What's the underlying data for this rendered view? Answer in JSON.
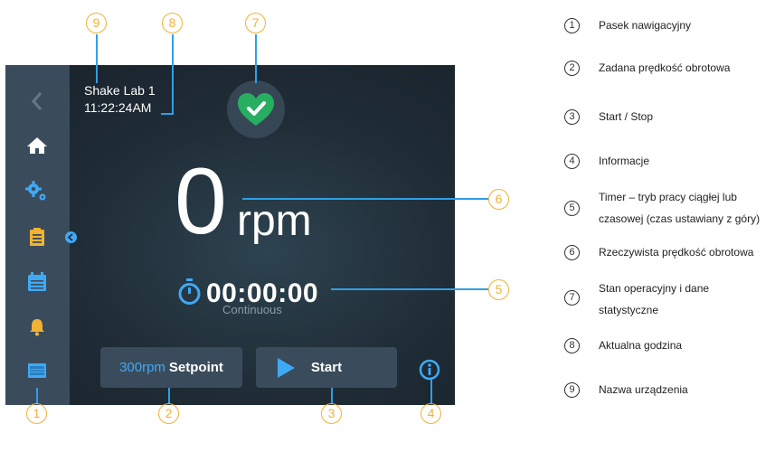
{
  "device": {
    "name": "Shake Lab 1",
    "time": "11:22:24AM",
    "speed_value": "0",
    "speed_unit": "rpm",
    "timer": "00:00:00",
    "timer_mode": "Continuous",
    "setpoint_value": "300rpm",
    "setpoint_label": "Setpoint",
    "start_label": "Start"
  },
  "sidebar_icons": [
    "back-chevron-icon",
    "home-icon",
    "settings-gears-icon",
    "clipboard-icon",
    "calendar-icon",
    "bell-icon",
    "screen-icon"
  ],
  "callouts": [
    "1",
    "2",
    "3",
    "4",
    "5",
    "6",
    "7",
    "8",
    "9"
  ],
  "legend": [
    {
      "num": "1",
      "text": "Pasek nawigacyjny"
    },
    {
      "num": "2",
      "text": "Zadana prędkość obrotowa"
    },
    {
      "num": "3",
      "text": "Start / Stop"
    },
    {
      "num": "4",
      "text": "Informacje"
    },
    {
      "num": "5",
      "text": "Timer – tryb pracy ciągłej lub czasowej (czas ustawiany z góry)"
    },
    {
      "num": "6",
      "text": "Rzeczywista prędkość obrotowa"
    },
    {
      "num": "7",
      "text": "Stan operacyjny i dane statystyczne"
    },
    {
      "num": "8",
      "text": "Aktualna godzina"
    },
    {
      "num": "9",
      "text": "Nazwa urządzenia"
    }
  ],
  "colors": {
    "accent": "#2f9fe6",
    "callout": "#f2b233",
    "heart": "#27ae60",
    "screen_bg": "#1f2b35",
    "sidebar": "#3a4b5b"
  }
}
